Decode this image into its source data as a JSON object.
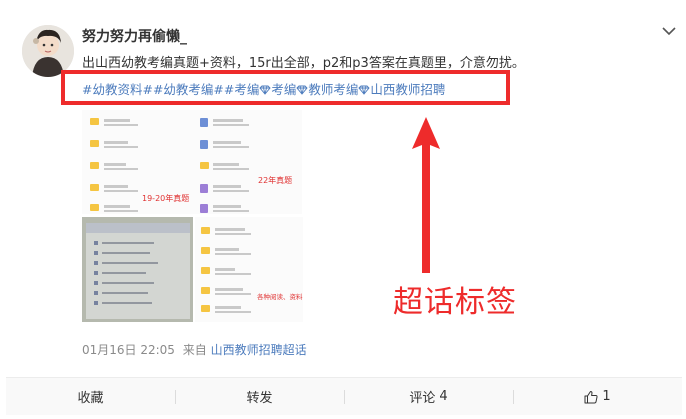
{
  "post": {
    "username": "努力努力再偷懒_",
    "content": "出山西幼教考编真题+资料，15r出全部，p2和p3答案在真题里，介意勿扰。",
    "tags": [
      "#幼教资料#",
      "#幼教考编#",
      "#考编",
      "考编",
      "教师考编",
      "山西教师招聘"
    ],
    "timestamp": "01月16日 22:05",
    "from_label": "来自",
    "source": "山西教师招聘超话"
  },
  "images": {
    "img1": {
      "left_label": "19-20年真题",
      "right_label": "22年真题"
    },
    "img3": {
      "label": "各种阅读、资料"
    }
  },
  "annotation": {
    "label": "超话标签",
    "color": "#ee2b2b"
  },
  "actions": {
    "collect": "收藏",
    "forward": "转发",
    "comment": "评论",
    "comment_count": "4",
    "like_count": "1"
  },
  "colors": {
    "link": "#4d7cbd",
    "highlight": "#ee2b2b",
    "meta": "#8a8a8a"
  }
}
